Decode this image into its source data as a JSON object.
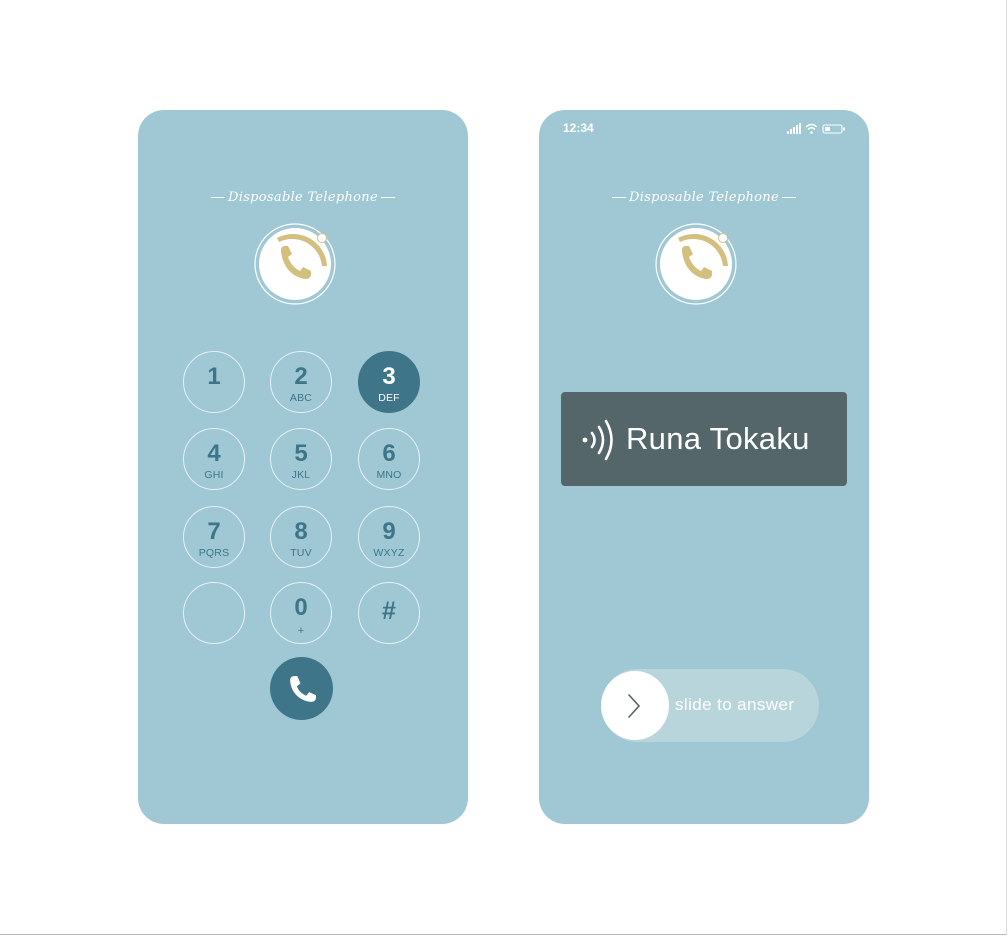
{
  "colors": {
    "phone_background": "#9fc8d4",
    "accent": "#3e7589",
    "logo_gold": "#d3bf7e",
    "caller_card": "#55666b",
    "slider_track": "#b8d5dc"
  },
  "dialer": {
    "brand_text": "Disposable Telephone",
    "keys": [
      {
        "digit": "1",
        "letters": ""
      },
      {
        "digit": "2",
        "letters": "ABC"
      },
      {
        "digit": "3",
        "letters": "DEF",
        "active": true
      },
      {
        "digit": "4",
        "letters": "GHI"
      },
      {
        "digit": "5",
        "letters": "JKL"
      },
      {
        "digit": "6",
        "letters": "MNO"
      },
      {
        "digit": "7",
        "letters": "PQRS"
      },
      {
        "digit": "8",
        "letters": "TUV"
      },
      {
        "digit": "9",
        "letters": "WXYZ"
      },
      {
        "digit": "",
        "letters": ""
      },
      {
        "digit": "0",
        "letters": "+"
      },
      {
        "digit": "#",
        "letters": ""
      }
    ],
    "call_button_icon": "phone-icon"
  },
  "incoming": {
    "status_time": "12:34",
    "status_icons": [
      "signal-icon",
      "wifi-icon",
      "battery-icon"
    ],
    "brand_text": "Disposable Telephone",
    "caller_name": "Runa Tokaku",
    "ringing_icon": "sound-waves-icon",
    "slide_label": "slide to answer",
    "slide_knob_icon": "chevron-right-icon"
  }
}
